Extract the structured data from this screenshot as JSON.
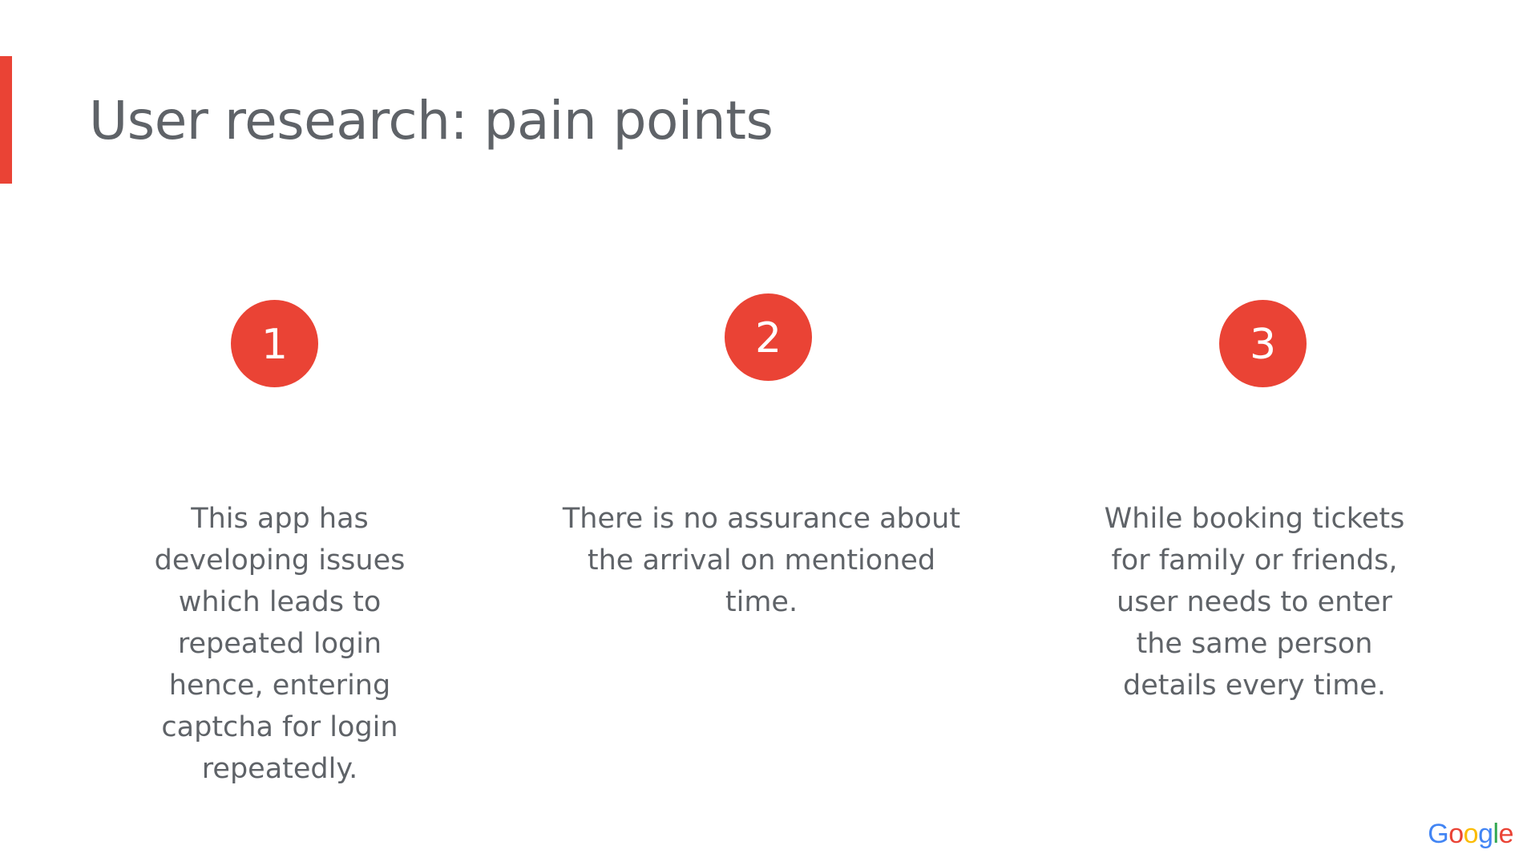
{
  "slide": {
    "title": "User research: pain points",
    "accent_color": "#ea4335",
    "text_color": "#5f6368"
  },
  "pain_points": [
    {
      "number": "1",
      "text": "This app has developing issues which leads to repeated login hence, entering captcha for login repeatedly."
    },
    {
      "number": "2",
      "text": "There is no assurance about the arrival on mentioned time."
    },
    {
      "number": "3",
      "text": "While booking tickets for family or friends, user needs to enter the same person details every time."
    }
  ],
  "logo": {
    "text": "Google",
    "colors": [
      "#4285f4",
      "#ea4335",
      "#fbbc05",
      "#4285f4",
      "#34a853",
      "#ea4335"
    ]
  }
}
